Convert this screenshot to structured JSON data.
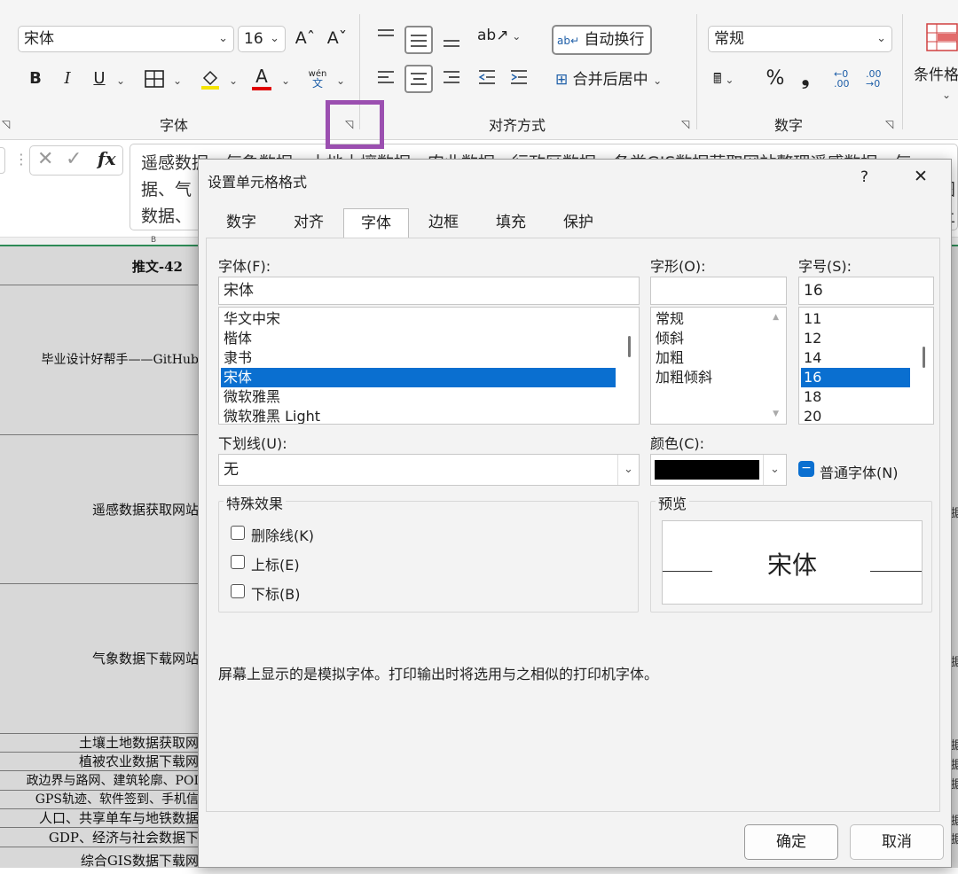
{
  "ribbon": {
    "font_name": "宋体",
    "font_size": "16",
    "grow_font": "Aˆ",
    "shrink_font": "Aˇ",
    "bold": "B",
    "italic": "I",
    "underline": "U",
    "phonetic_top": "wén",
    "phonetic_bottom": "文",
    "font_group_label": "字体",
    "wrap_text_label": "自动换行",
    "merge_label": "合并后居中",
    "align_group_label": "对齐方式",
    "number_format": "常规",
    "percent": "%",
    "comma": "❟",
    "number_group_label": "数字",
    "cond_format_label": "条件格",
    "colors": {
      "highlight": "#f5e400",
      "font_color": "#e00000",
      "accent_box": "#9b4fb0"
    }
  },
  "formula_bar": {
    "fx": "fx",
    "line1": "遥感数据、气象数据、土地土壤数据、农业数据、行政区数据、各类GIS数据获取网站整理遥感数据、气",
    "line2": "据、气",
    "line2_right": "图",
    "line3": "数据、",
    "line3_right": "上"
  },
  "sheet": {
    "col_header": "B",
    "cells": [
      "推文-42",
      "毕业设计好帮手——GitHub",
      "遥感数据获取网站",
      "气象数据下载网站",
      "土壤土地数据获取网",
      "植被农业数据下载网",
      "政边界与路网、建筑轮廓、POI",
      "GPS轨迹、软件签到、手机信",
      "人口、共享单车与地铁数据",
      "GDP、经济与社会数据下",
      "综合GIS数据下载网"
    ],
    "right_fragments": [
      "据",
      "据",
      "据",
      "据",
      "据",
      "据",
      "据"
    ]
  },
  "dialog": {
    "title": "设置单元格格式",
    "help": "?",
    "close": "✕",
    "tabs": [
      "数字",
      "对齐",
      "字体",
      "边框",
      "填充",
      "保护"
    ],
    "active_tab": "字体",
    "font_label": "字体(F):",
    "font_value": "宋体",
    "font_list": [
      "华文中宋",
      "楷体",
      "隶书",
      "宋体",
      "微软雅黑",
      "微软雅黑 Light"
    ],
    "font_selected": "宋体",
    "style_label": "字形(O):",
    "style_value": "",
    "style_list": [
      "常规",
      "倾斜",
      "加粗",
      "加粗倾斜"
    ],
    "size_label": "字号(S):",
    "size_value": "16",
    "size_list": [
      "11",
      "12",
      "14",
      "16",
      "18",
      "20"
    ],
    "size_selected": "16",
    "underline_label": "下划线(U):",
    "underline_value": "无",
    "color_label": "颜色(C):",
    "color_value": "#000000",
    "normal_font_label": "普通字体(N)",
    "effects_label": "特殊效果",
    "strikethrough_label": "删除线(K)",
    "superscript_label": "上标(E)",
    "subscript_label": "下标(B)",
    "preview_label": "预览",
    "preview_text": "宋体",
    "note": "屏幕上显示的是模拟字体。打印输出时将选用与之相似的打印机字体。",
    "ok": "确定",
    "cancel": "取消"
  }
}
